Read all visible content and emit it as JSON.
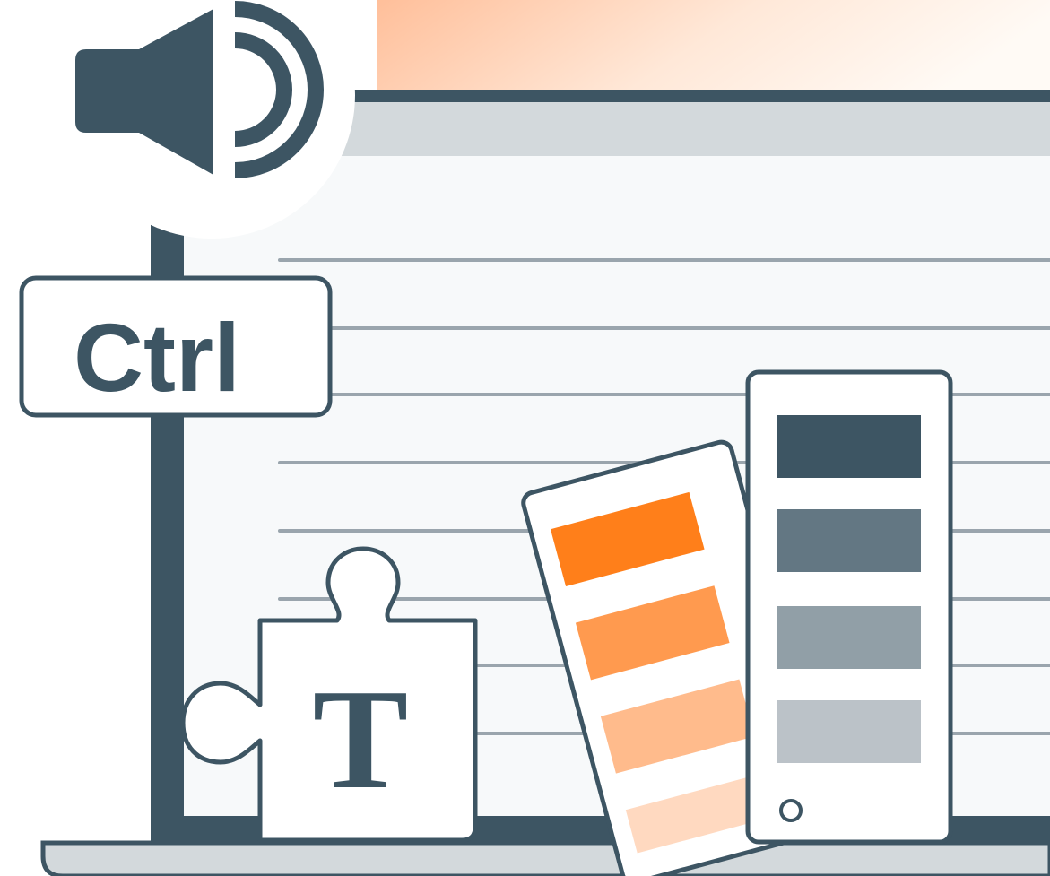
{
  "illustration": {
    "keyboard_key": {
      "label": "Ctrl"
    },
    "puzzle_piece": {
      "letter": "T"
    },
    "icons": [
      "speaker-volume-icon",
      "keyboard-key-icon",
      "puzzle-piece-icon",
      "color-swatch-fan-icon",
      "laptop-screen-icon"
    ],
    "colors": {
      "slate": "#3d5563",
      "banner_orange": "#ffc4a0",
      "swatch_orange": [
        "#ff7f1a",
        "#ff9a4f",
        "#ffbb8c",
        "#ffd9c0"
      ],
      "swatch_grey": [
        "#3d5563",
        "#637783",
        "#919fa7",
        "#bbc2c8"
      ]
    }
  }
}
